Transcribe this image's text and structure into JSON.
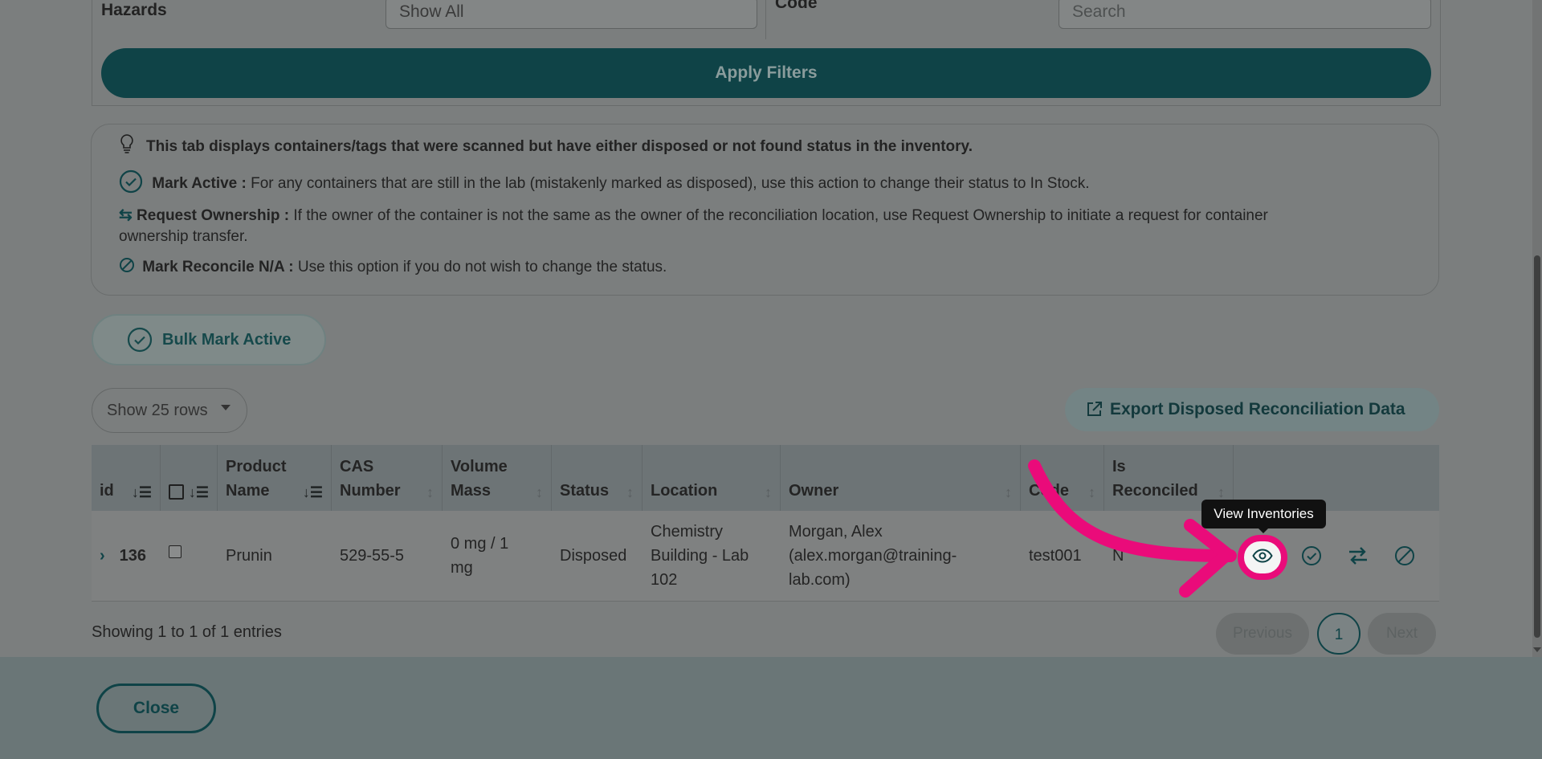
{
  "filters": {
    "hazards_label": "Hazards",
    "hazards_value": "Show All",
    "code_label": "Code",
    "code_placeholder": "Search",
    "apply_label": "Apply Filters"
  },
  "info": {
    "intro": "This tab displays containers/tags that were scanned but have either disposed or not found status in the inventory.",
    "mark_active_title": "Mark Active :",
    "mark_active_text": "For any containers that are still in the lab (mistakenly marked as disposed), use this action to change their status to In Stock.",
    "request_title": "Request Ownership :",
    "request_text_1": "If the owner of the container is not the same as the owner of the reconciliation location, use Request Ownership to initiate a request for container",
    "request_text_2": "ownership transfer.",
    "reconcile_title": "Mark Reconcile N/A :",
    "reconcile_text": "Use this option if you do not wish to change the status."
  },
  "bulk_label": "Bulk Mark Active",
  "rows_select": "Show 25 rows",
  "export_label": "Export Disposed Reconciliation Data",
  "table": {
    "headers": {
      "id": "id",
      "product_1": "Product",
      "product_2": "Name",
      "cas_1": "CAS",
      "cas_2": "Number",
      "vol_1": "Volume",
      "vol_2": "Mass",
      "status": "Status",
      "location": "Location",
      "owner": "Owner",
      "code": "Code",
      "rec_1": "Is",
      "rec_2": "Reconciled"
    },
    "row": {
      "id": "136",
      "product": "Prunin",
      "cas": "529-55-5",
      "vol_1": "0 mg / 1",
      "vol_2": "mg",
      "status": "Disposed",
      "loc_1": "Chemistry",
      "loc_2": "Building - Lab",
      "loc_3": "102",
      "owner_1": "Morgan, Alex",
      "owner_2": "(alex.morgan@training-",
      "owner_3": "lab.com)",
      "code": "test001",
      "reconciled": "N"
    }
  },
  "tooltip": "View Inventories",
  "showing": "Showing 1 to 1 of 1 entries",
  "pager": {
    "prev": "Previous",
    "page": "1",
    "next": "Next"
  },
  "close_label": "Close"
}
